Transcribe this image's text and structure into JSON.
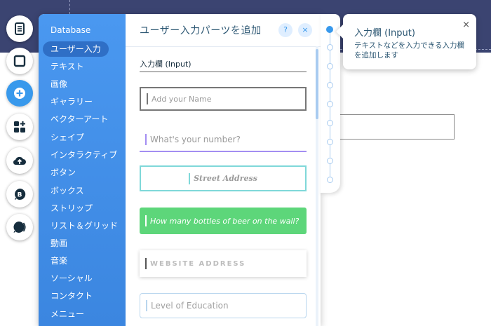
{
  "rail": {
    "items": [
      {
        "name": "pages-icon"
      },
      {
        "name": "background-icon"
      },
      {
        "name": "add-icon"
      },
      {
        "name": "app-market-icon"
      },
      {
        "name": "media-upload-icon"
      },
      {
        "name": "blog-icon"
      },
      {
        "name": "wix-music-icon"
      }
    ]
  },
  "categories": [
    "Database",
    "ユーザー入力",
    "テキスト",
    "画像",
    "ギャラリー",
    "ベクターアート",
    "シェイプ",
    "インタラクティブ",
    "ボタン",
    "ボックス",
    "ストリップ",
    "リスト＆グリッド",
    "動画",
    "音楽",
    "ソーシャル",
    "コンタクト",
    "メニュー"
  ],
  "selected_category": "ユーザー入力",
  "panel": {
    "title": "ユーザー入力パーツを追加",
    "help": "?",
    "close": "×",
    "section_label": "入力欄 (Input)",
    "samples": [
      "Add your Name",
      "What's your number?",
      "Street Address",
      "How many bottles of beer on the wall?",
      "WEBSITE ADDRESS",
      "Level of Education"
    ]
  },
  "tooltip": {
    "title": "入力欄 (Input)",
    "description": "テキストなどを入力できる入力欄を追加します",
    "close": "×"
  },
  "colors": {
    "accent": "#3899ec",
    "topband": "#3b4471",
    "category_bg": "#4a98f0",
    "green_sample": "#5dd67a"
  }
}
